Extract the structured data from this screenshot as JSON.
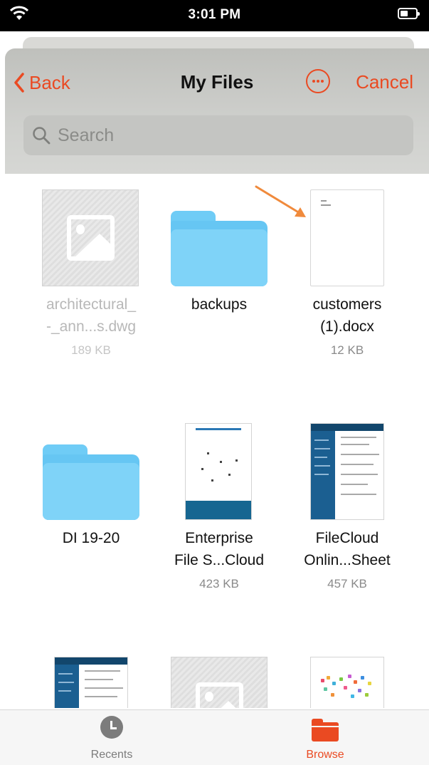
{
  "status_bar": {
    "time": "3:01 PM",
    "wifi_icon": "wifi-icon",
    "battery_icon": "battery-icon"
  },
  "header": {
    "back_label": "Back",
    "title": "My Files",
    "more_icon": "ellipsis-circle-icon",
    "cancel_label": "Cancel",
    "search_placeholder": "Search"
  },
  "files": [
    {
      "name": "architectural_\n-_ann...s.dwg",
      "size": "189 KB",
      "kind": "image",
      "dimmed": true
    },
    {
      "name": "backups",
      "size": "",
      "kind": "folder",
      "dimmed": false
    },
    {
      "name": "customers\n(1).docx",
      "size": "12 KB",
      "kind": "document",
      "dimmed": false
    },
    {
      "name": "DI 19-20",
      "size": "",
      "kind": "folder",
      "dimmed": false
    },
    {
      "name": "Enterprise\nFile S...Cloud",
      "size": "423 KB",
      "kind": "pdf",
      "dimmed": false
    },
    {
      "name": "FileCloud\nOnlin...Sheet",
      "size": "457 KB",
      "kind": "sheet",
      "dimmed": false
    },
    {
      "name": "",
      "size": "",
      "kind": "sheet",
      "dimmed": false
    },
    {
      "name": "",
      "size": "",
      "kind": "image",
      "dimmed": true
    },
    {
      "name": "",
      "size": "",
      "kind": "map",
      "dimmed": false
    }
  ],
  "tab_bar": {
    "recents_label": "Recents",
    "browse_label": "Browse",
    "recents_icon": "clock-icon",
    "browse_icon": "folder-icon"
  },
  "colors": {
    "accent": "#ea4a22",
    "folder": "#6fccf6",
    "tab_inactive": "#7c7c7c"
  }
}
